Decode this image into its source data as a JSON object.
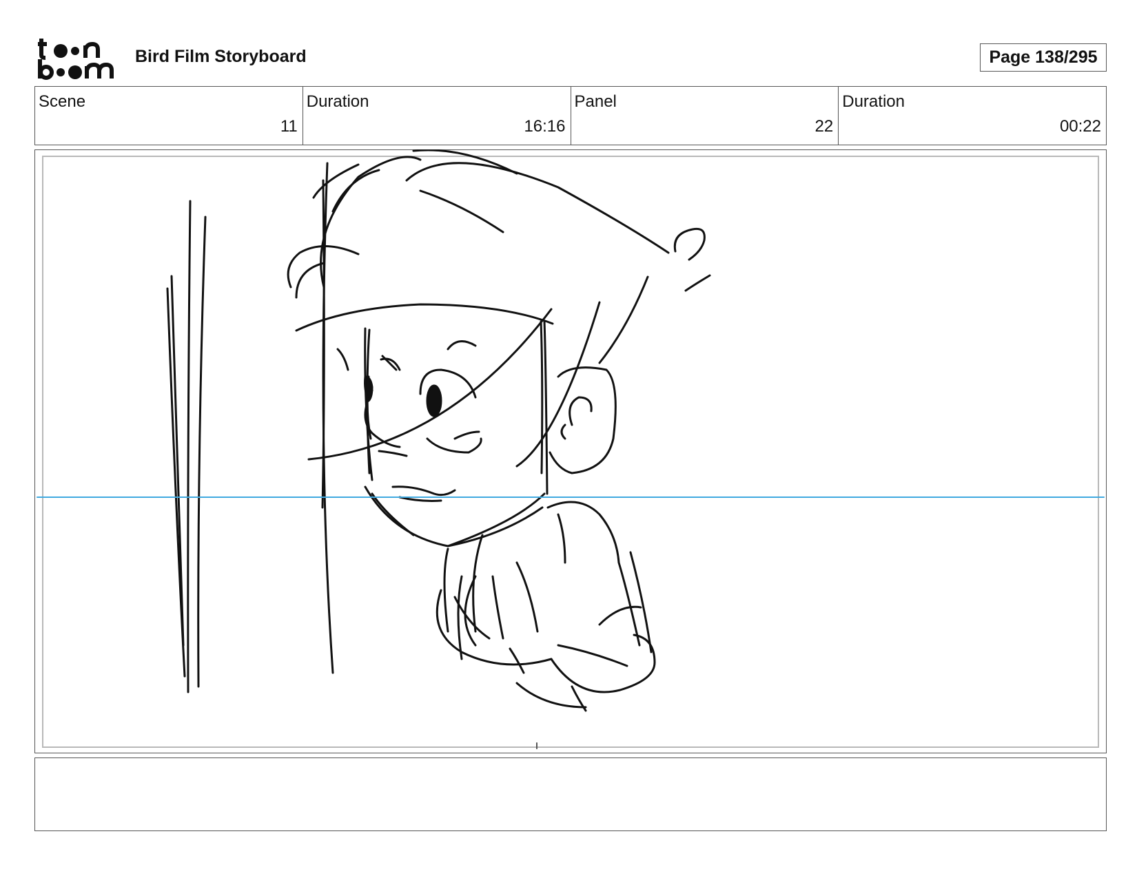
{
  "header": {
    "logo": {
      "line1": "toon",
      "line2": "boom"
    },
    "title": "Bird Film Storyboard",
    "page": "Page 138/295"
  },
  "info": [
    {
      "label": "Scene",
      "value": "11"
    },
    {
      "label": "Duration",
      "value": "16:16"
    },
    {
      "label": "Panel",
      "value": "22"
    },
    {
      "label": "Duration",
      "value": "00:22"
    }
  ],
  "panel": {
    "content": "pencil sketch of a boy with a large swept quiff holding his hands together",
    "guide_line_color": "#3fa9e0"
  },
  "notes": {
    "text": ""
  }
}
